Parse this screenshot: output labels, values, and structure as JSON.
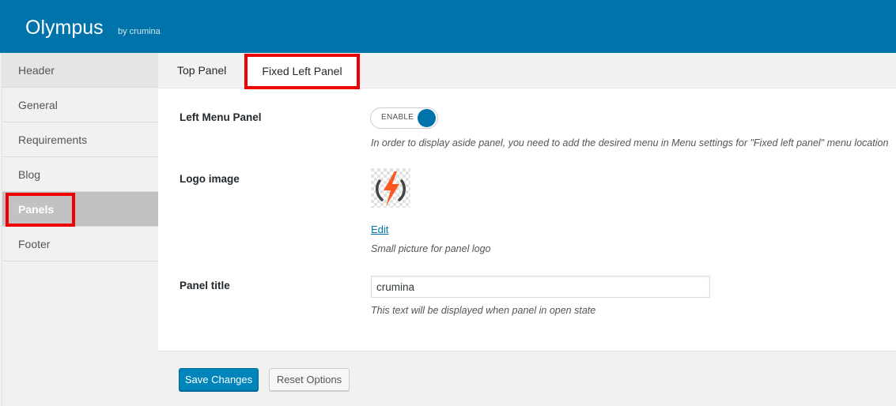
{
  "header": {
    "title": "Olympus",
    "byline": "by crumina"
  },
  "sidebar": {
    "items": [
      {
        "label": "Header"
      },
      {
        "label": "General"
      },
      {
        "label": "Requirements"
      },
      {
        "label": "Blog"
      },
      {
        "label": "Panels",
        "active": true
      },
      {
        "label": "Footer"
      }
    ]
  },
  "tabs": [
    {
      "label": "Top Panel"
    },
    {
      "label": "Fixed Left Panel",
      "active": true
    }
  ],
  "settings": {
    "left_menu": {
      "label": "Left Menu Panel",
      "toggle_text": "ENABLE",
      "toggle_state": "on",
      "description": "In order to display aside panel, you need to add the desired menu in Menu settings for \"Fixed left panel\" menu location"
    },
    "logo": {
      "label": "Logo image",
      "image_icon": "lightning-bolt-logo-icon",
      "edit_label": "Edit",
      "description": "Small picture for panel logo"
    },
    "panel_title": {
      "label": "Panel title",
      "value": "crumina",
      "description": "This text will be displayed when panel in open state"
    }
  },
  "actions": {
    "save_label": "Save Changes",
    "reset_label": "Reset Options"
  },
  "colors": {
    "brand": "#0073aa",
    "highlight": "#ee0000",
    "logo_bolt": "#ff5722"
  }
}
